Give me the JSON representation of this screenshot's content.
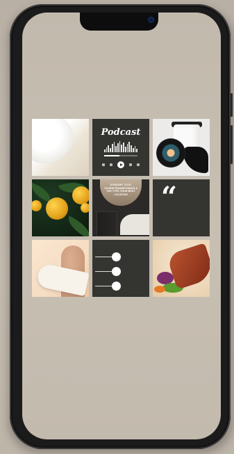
{
  "podcast_card": {
    "title": "Podcast",
    "progress": 0.45,
    "controls": [
      "prev-icon",
      "rewind-icon",
      "play-icon",
      "forward-icon",
      "next-icon"
    ]
  },
  "interior_card": {
    "caption": "STRAIGHT TO AT YOURSITENAMETHINGS & THE TYPE YOUR BEST LOCATION"
  },
  "quote_card": {
    "mark": "“"
  },
  "colors": {
    "dark_tile": "#343531",
    "screen_bg": "#c4bbaf"
  }
}
